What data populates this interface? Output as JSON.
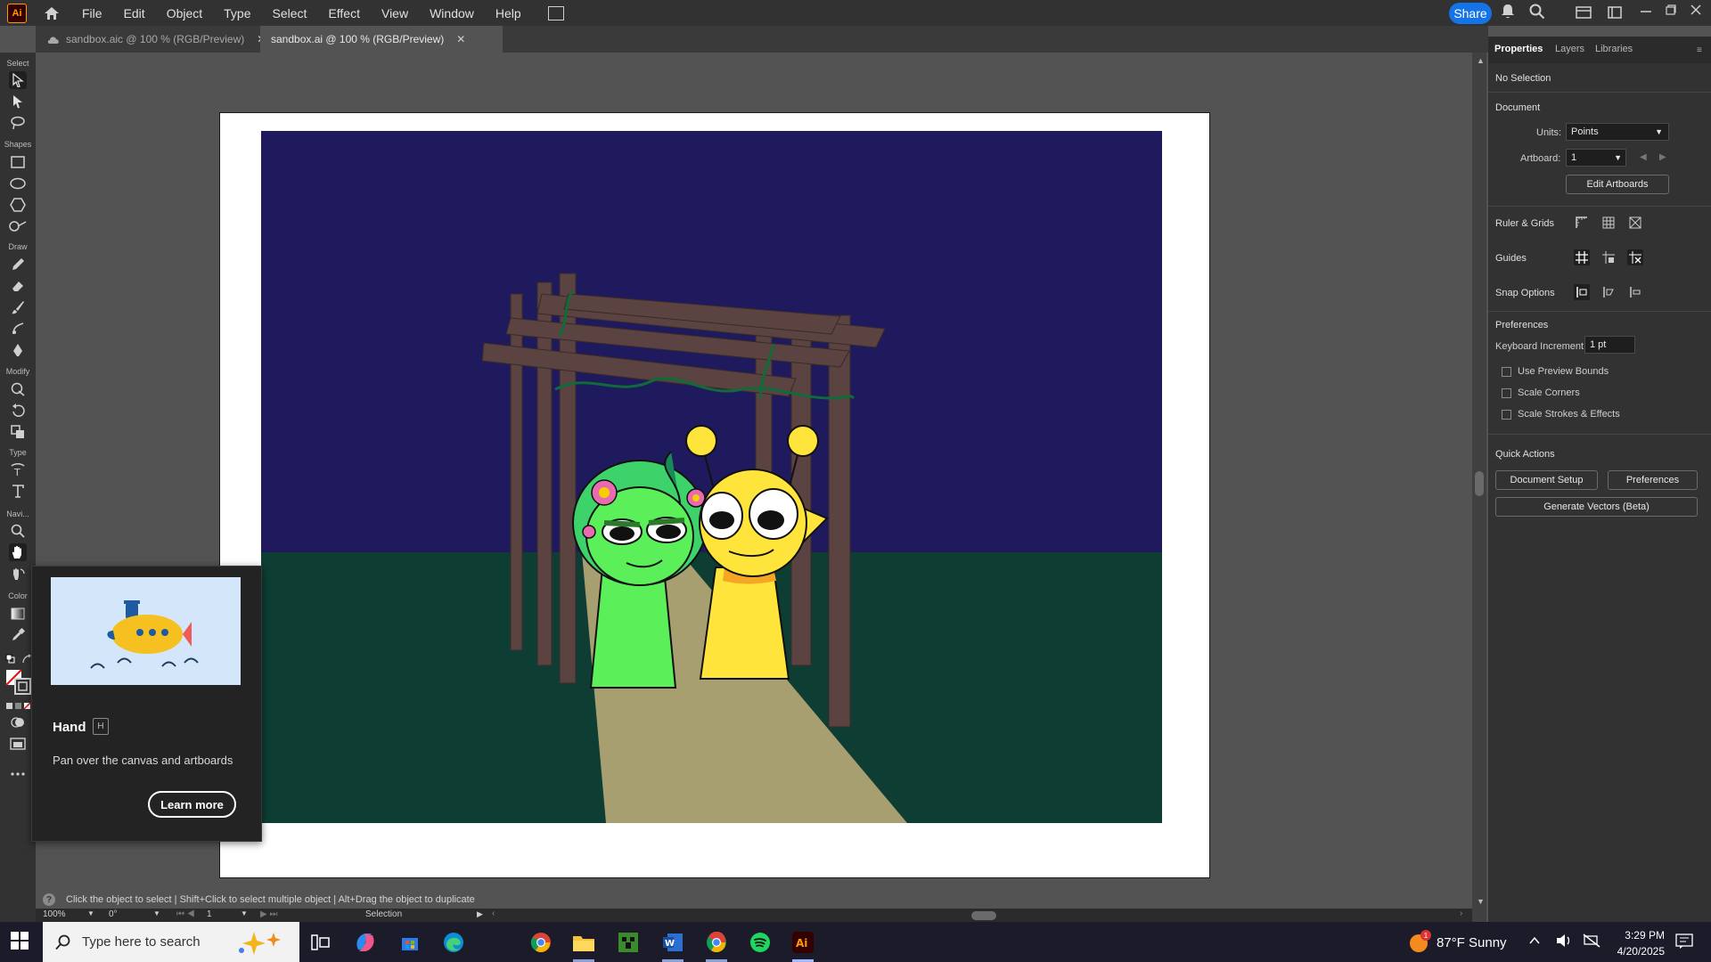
{
  "app": {
    "logo_text": "Ai"
  },
  "menu": [
    "File",
    "Edit",
    "Object",
    "Type",
    "Select",
    "Effect",
    "View",
    "Window",
    "Help"
  ],
  "header": {
    "share_label": "Share"
  },
  "tabs": [
    {
      "label": "sandbox.aic @ 100 % (RGB/Preview)",
      "active": false
    },
    {
      "label": "sandbox.ai @ 100 % (RGB/Preview)",
      "active": true
    }
  ],
  "toolbar": {
    "groups": [
      "Select",
      "Shapes",
      "Draw",
      "Modify",
      "Type",
      "Navi...",
      "Color"
    ]
  },
  "tooltip": {
    "title": "Hand",
    "shortcut": "H",
    "description": "Pan over the canvas and artboards",
    "button": "Learn more"
  },
  "panel": {
    "tabs": [
      "Properties",
      "Layers",
      "Libraries"
    ],
    "no_selection": "No Selection",
    "document_heading": "Document",
    "units_label": "Units:",
    "units_value": "Points",
    "artboard_label": "Artboard:",
    "artboard_value": "1",
    "edit_artboards": "Edit Artboards",
    "ruler_grids": "Ruler & Grids",
    "guides": "Guides",
    "snap_options": "Snap Options",
    "preferences_heading": "Preferences",
    "keyboard_increment_label": "Keyboard Increment:",
    "keyboard_increment_value": "1 pt",
    "checkboxes": [
      "Use Preview Bounds",
      "Scale Corners",
      "Scale Strokes & Effects"
    ],
    "quick_actions": "Quick Actions",
    "document_setup": "Document Setup",
    "preferences_btn": "Preferences",
    "generate_vectors": "Generate Vectors (Beta)"
  },
  "status": {
    "hint": "Click the object to select  |  Shift+Click to select multiple object  |  Alt+Drag the object to duplicate",
    "zoom": "100%",
    "rotation": "0°",
    "artboard_num": "1",
    "tool": "Selection"
  },
  "taskbar": {
    "search_placeholder": "Type here to search",
    "weather": "87°F  Sunny",
    "time": "3:29 PM",
    "date": "4/20/2025",
    "notification_badge": "1"
  },
  "colors": {
    "accent": "#1473e6",
    "sky": "#1f1a5e",
    "ground": "#0e3d33",
    "path": "#a89f70",
    "wood": "#5a4340",
    "green_char": "#5bf05a",
    "yellow_char": "#ffe53b"
  }
}
